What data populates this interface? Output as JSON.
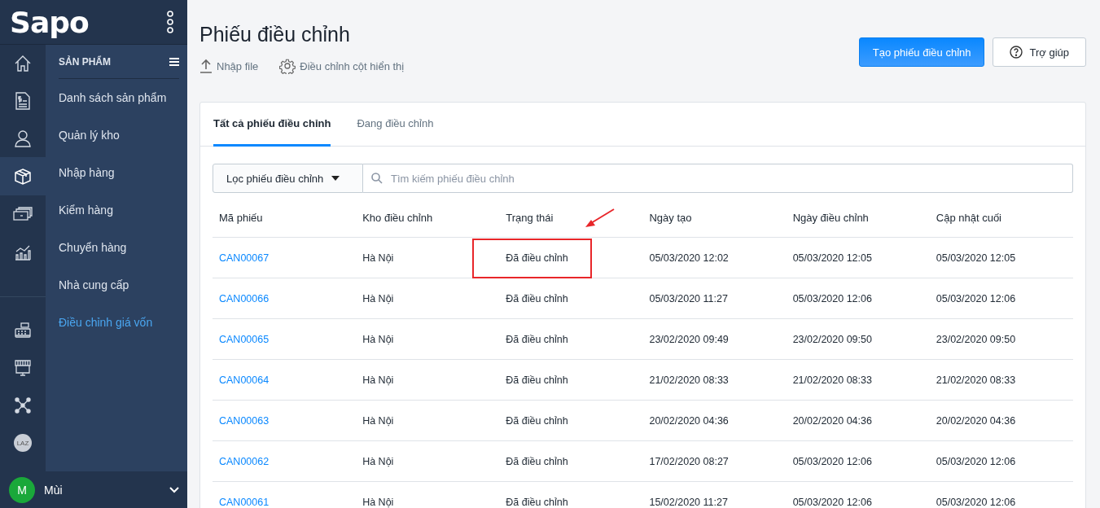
{
  "brand": {
    "logo": "Sapo"
  },
  "rail": [
    {
      "kind": "home",
      "selected": false
    },
    {
      "kind": "document",
      "selected": false
    },
    {
      "kind": "user",
      "selected": false
    },
    {
      "kind": "box",
      "selected": true
    },
    {
      "kind": "money",
      "selected": false
    },
    {
      "kind": "chart",
      "selected": false
    },
    {
      "kind": "register",
      "selected": false
    },
    {
      "kind": "store",
      "selected": false
    },
    {
      "kind": "network",
      "selected": false
    },
    {
      "kind": "laz",
      "label": "LAZ",
      "selected": false
    }
  ],
  "menu": {
    "title": "SẢN PHẨM",
    "items": [
      {
        "label": "Danh sách sản phẩm",
        "selected": false
      },
      {
        "label": "Quản lý kho",
        "selected": false
      },
      {
        "label": "Nhập hàng",
        "selected": false
      },
      {
        "label": "Kiểm hàng",
        "selected": false
      },
      {
        "label": "Chuyển hàng",
        "selected": false
      },
      {
        "label": "Nhà cung cấp",
        "selected": false
      },
      {
        "label": "Điều chỉnh giá vốn",
        "selected": true
      }
    ]
  },
  "user": {
    "initial": "M",
    "name": "Mùi"
  },
  "page": {
    "title": "Phiếu điều chỉnh",
    "actions": [
      {
        "kind": "upload",
        "label": "Nhập file"
      },
      {
        "kind": "settings",
        "label": "Điều chỉnh cột hiển thị"
      }
    ],
    "primary_button": "Tạo phiếu điều chỉnh",
    "help_button": "Trợ giúp"
  },
  "tabs": [
    {
      "label": "Tất cả phiếu điều chỉnh",
      "selected": true
    },
    {
      "label": "Đang điều chỉnh",
      "selected": false
    }
  ],
  "filter": {
    "label": "Lọc phiếu điều chỉnh"
  },
  "search": {
    "placeholder": "Tìm kiếm phiếu điều chỉnh"
  },
  "table": {
    "columns": [
      "Mã phiếu",
      "Kho điều chỉnh",
      "Trạng thái",
      "Ngày tạo",
      "Ngày điều chỉnh",
      "Cập nhật cuối"
    ],
    "rows": [
      {
        "code": "CAN00067",
        "warehouse": "Hà Nội",
        "status": "Đã điều chỉnh",
        "created": "05/03/2020 12:02",
        "adjusted": "05/03/2020 12:05",
        "updated": "05/03/2020 12:05",
        "highlighted": true
      },
      {
        "code": "CAN00066",
        "warehouse": "Hà Nội",
        "status": "Đã điều chỉnh",
        "created": "05/03/2020 11:27",
        "adjusted": "05/03/2020 12:06",
        "updated": "05/03/2020 12:06",
        "highlighted": false
      },
      {
        "code": "CAN00065",
        "warehouse": "Hà Nội",
        "status": "Đã điều chỉnh",
        "created": "23/02/2020 09:49",
        "adjusted": "23/02/2020 09:50",
        "updated": "23/02/2020 09:50",
        "highlighted": false
      },
      {
        "code": "CAN00064",
        "warehouse": "Hà Nội",
        "status": "Đã điều chỉnh",
        "created": "21/02/2020 08:33",
        "adjusted": "21/02/2020 08:33",
        "updated": "21/02/2020 08:33",
        "highlighted": false
      },
      {
        "code": "CAN00063",
        "warehouse": "Hà Nội",
        "status": "Đã điều chỉnh",
        "created": "20/02/2020 04:36",
        "adjusted": "20/02/2020 04:36",
        "updated": "20/02/2020 04:36",
        "highlighted": false
      },
      {
        "code": "CAN00062",
        "warehouse": "Hà Nội",
        "status": "Đã điều chỉnh",
        "created": "17/02/2020 08:27",
        "adjusted": "05/03/2020 12:06",
        "updated": "05/03/2020 12:06",
        "highlighted": false
      },
      {
        "code": "CAN00061",
        "warehouse": "Hà Nội",
        "status": "Đã điều chỉnh",
        "created": "15/02/2020 11:27",
        "adjusted": "05/03/2020 12:06",
        "updated": "05/03/2020 12:06",
        "highlighted": false
      }
    ]
  }
}
